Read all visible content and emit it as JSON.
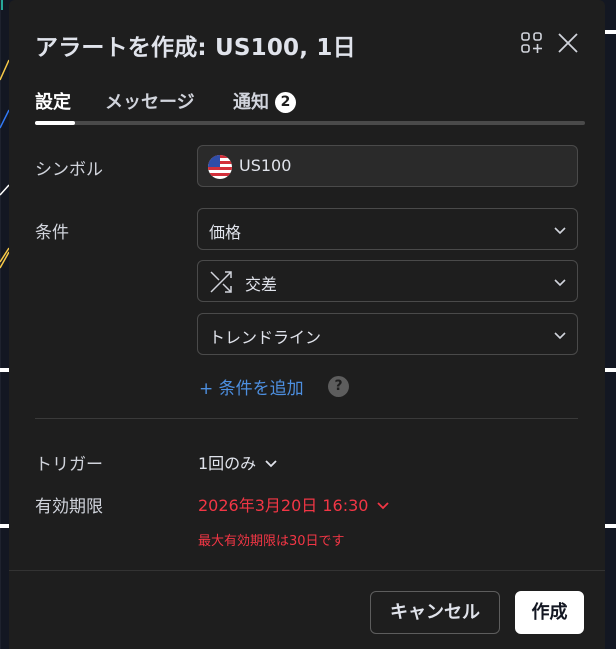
{
  "dialog": {
    "title": "アラートを作成: US100, 1日"
  },
  "tabs": [
    {
      "label": "設定",
      "active": true
    },
    {
      "label": "メッセージ",
      "active": false
    },
    {
      "label": "通知",
      "active": false,
      "badge": "2"
    }
  ],
  "symbol": {
    "label": "シンボル",
    "value": "US100",
    "flag_icon": "us-flag-icon"
  },
  "condition": {
    "label": "条件",
    "source": "価格",
    "operator": "交差",
    "operator_icon": "crossing-icon",
    "target": "トレンドライン",
    "add_label": "+ 条件を追加",
    "help": "?"
  },
  "trigger": {
    "label": "トリガー",
    "value": "1回のみ"
  },
  "expiry": {
    "label": "有効期限",
    "value": "2026年3月20日 16:30",
    "warning": "最大有効期限は30日です"
  },
  "buttons": {
    "cancel": "キャンセル",
    "create": "作成"
  },
  "colors": {
    "background": "#1e1e1e",
    "accent_link": "#4d8fe0",
    "error": "#f23645",
    "primary_button": "#ffffff"
  }
}
